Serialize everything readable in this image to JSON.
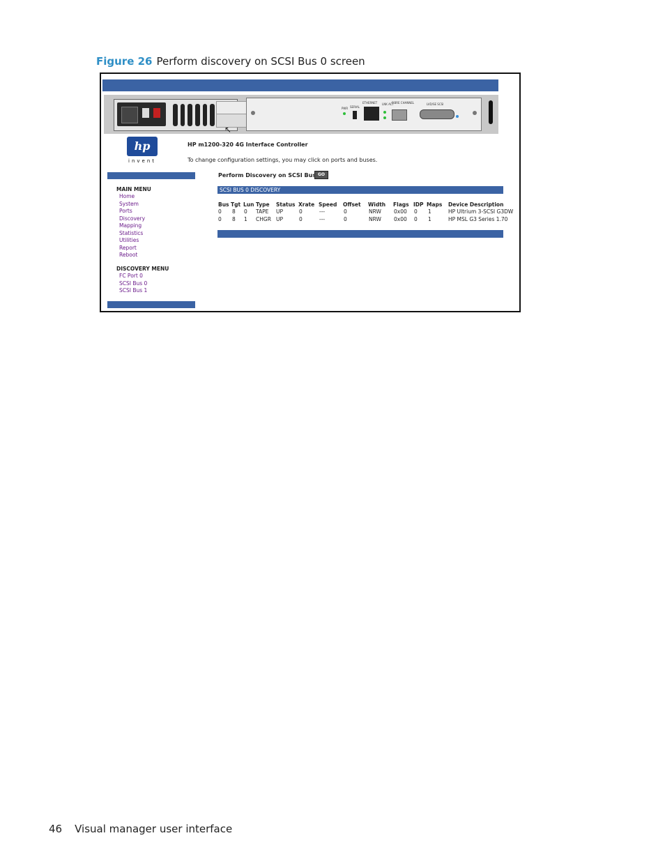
{
  "caption": {
    "figure_label": "Figure 26",
    "title": "Perform discovery on SCSI Bus 0 screen"
  },
  "footer": {
    "page_number": "46",
    "text": "Visual manager user interface"
  },
  "device_panel": {
    "port_labels": [
      "PWR",
      "SERIAL",
      "ETHERNET",
      "LNK ACT",
      "FIBRE CHANNEL",
      "LVD/SE SCSI"
    ]
  },
  "header": {
    "logo_text": "hp",
    "invent": "invent",
    "product_title": "HP m1200-320 4G Interface Controller",
    "instructions": "To change configuration settings, you may click on ports and buses."
  },
  "sidebar": {
    "main_menu_title": "MAIN MENU",
    "main_menu": [
      "Home",
      "System",
      "Ports",
      "Discovery",
      "Mapping",
      "Statistics",
      "Utilities",
      "Report",
      "Reboot"
    ],
    "discovery_menu_title": "DISCOVERY MENU",
    "discovery_menu": [
      "FC Port 0",
      "SCSI Bus 0",
      "SCSI Bus 1"
    ]
  },
  "main": {
    "discovery_prompt": "Perform Discovery on SCSI Bus 0:",
    "go_label": "GO",
    "section_title": "SCSI BUS 0 DISCOVERY",
    "columns": [
      "Bus",
      "Tgt",
      "Lun",
      "Type",
      "Status",
      "Xrate",
      "Speed",
      "Offset",
      "Width",
      "Flags",
      "IDP",
      "Maps",
      "Device Description"
    ],
    "rows": [
      [
        "0",
        "8",
        "0",
        "TAPE",
        "UP",
        "0",
        "---",
        "0",
        "NRW",
        "0x00",
        "0",
        "1",
        "HP Ultrium 3-SCSI G3DW"
      ],
      [
        "0",
        "8",
        "1",
        "CHGR",
        "UP",
        "0",
        "---",
        "0",
        "NRW",
        "0x00",
        "0",
        "1",
        "HP MSL G3 Series 1.70"
      ]
    ]
  },
  "colors": {
    "accent_bar": "#3b63a4",
    "menu_link": "#6a1a8a",
    "figure_label": "#2f8fc6"
  }
}
